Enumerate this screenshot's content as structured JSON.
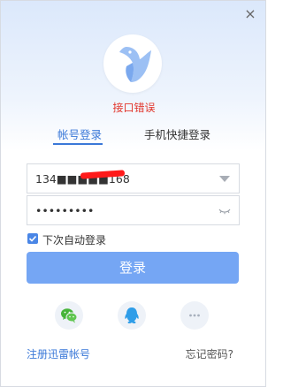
{
  "window": {
    "close_icon": "close-icon",
    "close_symbol": "×"
  },
  "avatar": {
    "icon": "hummingbird-logo-icon",
    "colors": {
      "bird": "#9cc0f4",
      "bird_dark": "#7aa8ee"
    }
  },
  "error_message": "接口错误",
  "tabs": [
    {
      "label": "帐号登录",
      "active": true
    },
    {
      "label": "手机快捷登录",
      "active": false
    }
  ],
  "phone_input": {
    "value": "134■■■■■168",
    "placeholder": ""
  },
  "password_input": {
    "value": "•••••••••",
    "placeholder": ""
  },
  "auto_login": {
    "label": "下次自动登录",
    "checked": true
  },
  "login_button": {
    "label": "登录"
  },
  "social": [
    {
      "name": "wechat",
      "icon": "wechat-icon"
    },
    {
      "name": "qq",
      "icon": "qq-icon"
    },
    {
      "name": "more",
      "icon": "more-icon"
    }
  ],
  "register_link": "注册迅雷帐号",
  "forgot_link": "忘记密码?",
  "colors": {
    "accent": "#3a78d8",
    "button": "#75a6f4",
    "error": "#e2362c"
  }
}
